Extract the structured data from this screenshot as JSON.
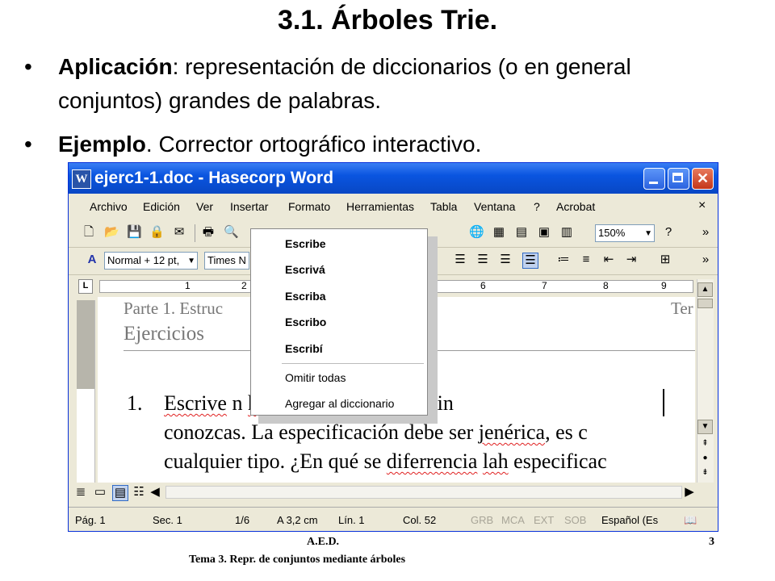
{
  "slide": {
    "title": "3.1. Árboles Trie.",
    "bullets": [
      {
        "bold": "Aplicación",
        "rest": ": representación de diccionarios (o en general conjuntos) grandes de palabras."
      },
      {
        "bold": "Ejemplo",
        "rest": ". Corrector ortográfico interactivo."
      }
    ],
    "bullet_symbol": "•",
    "footer": {
      "course": "A.E.D.",
      "page": "3",
      "subtitle": "Tema 3. Repr. de conjuntos mediante árboles"
    }
  },
  "window": {
    "title": "ejerc1-1.doc - Hasecorp Word",
    "app_icon": "W",
    "menu": [
      "Archivo",
      "Edición",
      "Ver",
      "Insertar",
      "Formato",
      "Herramientas",
      "Tabla",
      "Ventana",
      "?",
      "Acrobat"
    ],
    "menu_close": "×",
    "zoom": "150%",
    "style": "Normal + 12 pt,",
    "font": "Times N",
    "ruler_numbers": [
      "1",
      "2",
      "6",
      "7",
      "8",
      "9"
    ],
    "ruler_tab": "L"
  },
  "document": {
    "header_left": "Parte 1. Estruc",
    "header_right": "Ter",
    "header_sub": "Ejercicios",
    "list_number": "1.",
    "lines": [
      {
        "segments": [
          {
            "t": "Escrive",
            "err": true
          },
          {
            "t": " ",
            "err": false
          },
          {
            "t": "n ",
            "err": false
          },
          {
            "t": "hinformal",
            "err": true
          },
          {
            "t": " para los distin",
            "err": false
          }
        ]
      },
      {
        "segments": [
          {
            "t": "conozcas",
            "err": false
          },
          {
            "t": ". La especificación debe ser ",
            "err": false
          },
          {
            "t": "jenérica",
            "err": true
          },
          {
            "t": ", es c",
            "err": false
          }
        ]
      },
      {
        "segments": [
          {
            "t": "cualquier tipo. ¿En qué se ",
            "err": false
          },
          {
            "t": "diferrencia",
            "err": true
          },
          {
            "t": " ",
            "err": false
          },
          {
            "t": "lah",
            "err": true
          },
          {
            "t": " especificac",
            "err": false
          }
        ]
      }
    ]
  },
  "context_menu": {
    "suggestions": [
      "Escribe",
      "Escrivá",
      "Escriba",
      "Escribo",
      "Escribí"
    ],
    "actions": [
      "Omitir todas",
      "Agregar al diccionario"
    ]
  },
  "status_bar": {
    "page": "Pág. 1",
    "section": "Sec. 1",
    "pages": "1/6",
    "at": "A 3,2 cm",
    "line": "Lín. 1",
    "col": "Col. 52",
    "modes": [
      "GRB",
      "MCA",
      "EXT",
      "SOB"
    ],
    "language": "Español (Es"
  }
}
